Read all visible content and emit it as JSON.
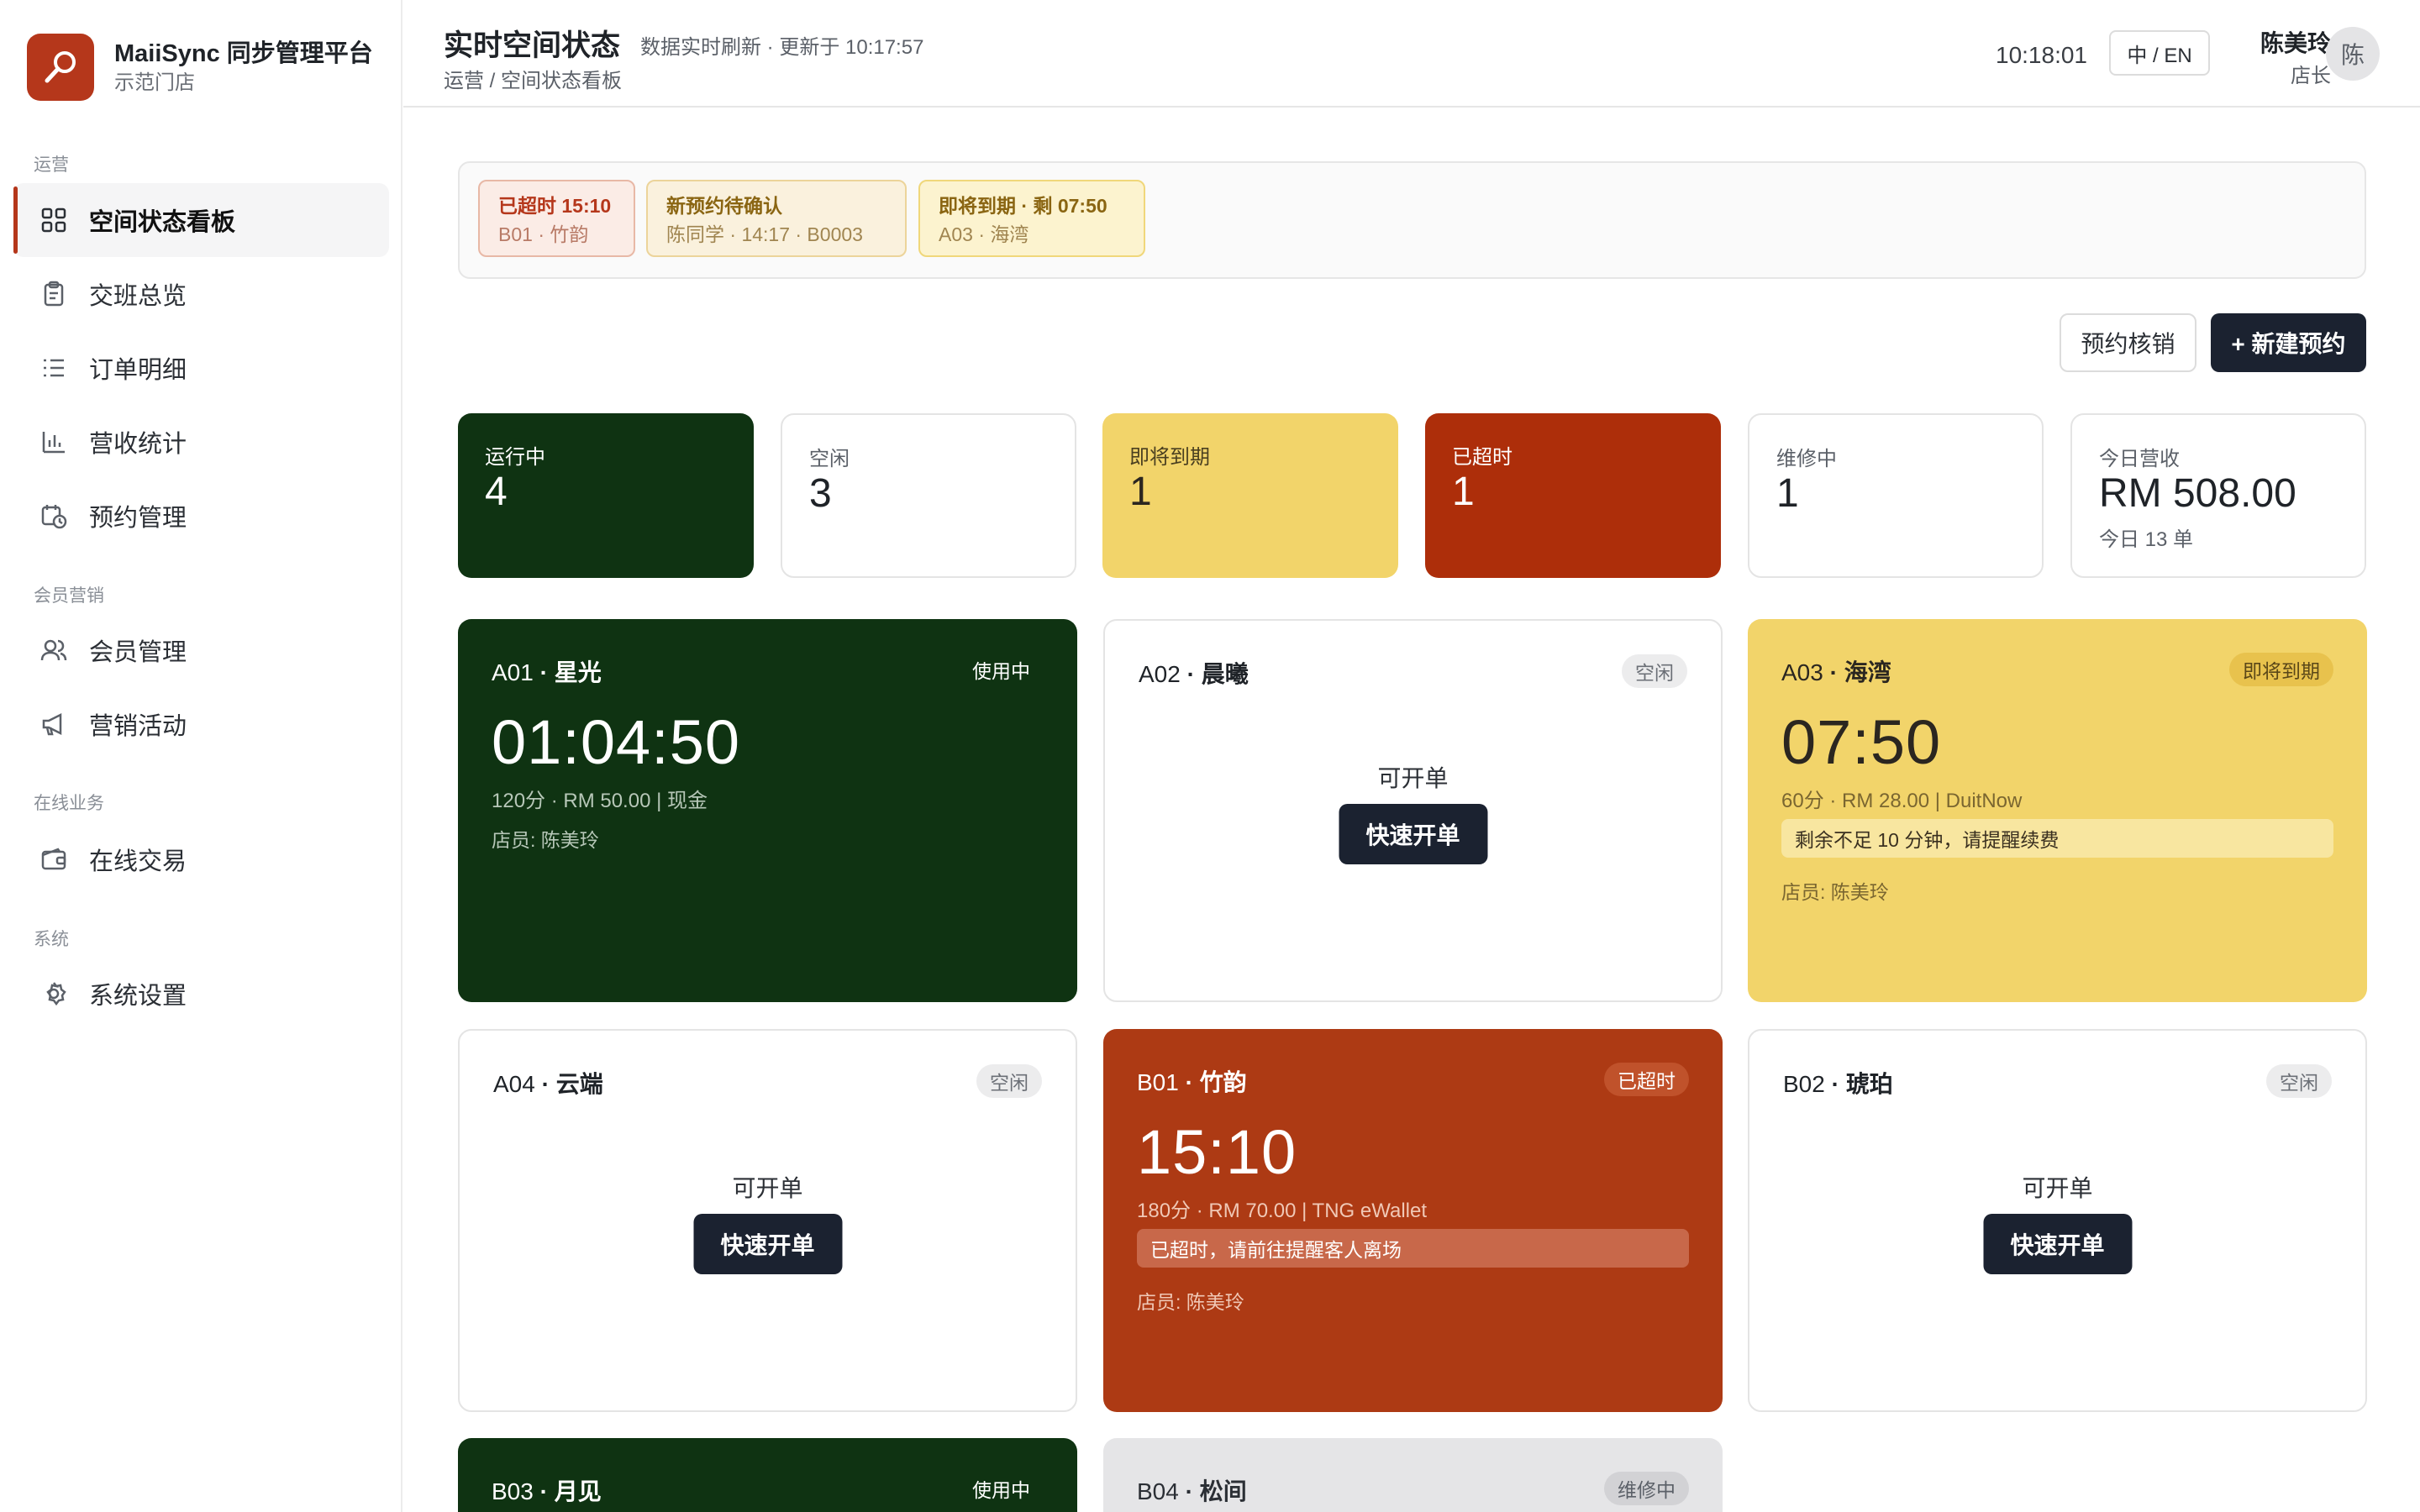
{
  "brand": {
    "name": "MaiiSync 同步管理平台",
    "store": "示范门店"
  },
  "sidebar": {
    "groups": [
      {
        "label": "运营"
      },
      {
        "label": "会员营销"
      },
      {
        "label": "在线业务"
      },
      {
        "label": "系统"
      }
    ],
    "items": [
      {
        "label": "空间状态看板",
        "icon": "grid-icon",
        "active": true
      },
      {
        "label": "交班总览",
        "icon": "clipboard-icon"
      },
      {
        "label": "订单明细",
        "icon": "list-icon"
      },
      {
        "label": "营收统计",
        "icon": "bar-chart-icon"
      },
      {
        "label": "预约管理",
        "icon": "calendar-clock-icon"
      },
      {
        "label": "会员管理",
        "icon": "users-icon"
      },
      {
        "label": "营销活动",
        "icon": "megaphone-icon"
      },
      {
        "label": "在线交易",
        "icon": "wallet-icon"
      },
      {
        "label": "系统设置",
        "icon": "gear-icon"
      }
    ]
  },
  "header": {
    "title": "实时空间状态",
    "refresh": "数据实时刷新 · 更新于 10:17:57",
    "breadcrumb": "运营 / 空间状态看板",
    "clock": "10:18:01",
    "lang": "中 / EN",
    "user_name": "陈美玲",
    "user_role": "店长",
    "avatar_text": "陈"
  },
  "alerts": [
    {
      "title": "已超时 15:10",
      "sub": "B01 · 竹韵",
      "tone": "red"
    },
    {
      "title": "新预约待确认",
      "sub": "陈同学 · 14:17 · B0003",
      "tone": "amber"
    },
    {
      "title": "即将到期 · 剩 07:50",
      "sub": "A03 · 海湾",
      "tone": "yellow"
    }
  ],
  "actions": {
    "verify": "预约核销",
    "new_booking": "+ 新建预约"
  },
  "stats": [
    {
      "label": "运行中",
      "value": "4",
      "tone": "green"
    },
    {
      "label": "空闲",
      "value": "3",
      "tone": "white"
    },
    {
      "label": "即将到期",
      "value": "1",
      "tone": "yellow"
    },
    {
      "label": "已超时",
      "value": "1",
      "tone": "red"
    },
    {
      "label": "维修中",
      "value": "1",
      "tone": "white"
    },
    {
      "label": "今日营收",
      "value": "RM 508.00",
      "sub": "今日 13 单",
      "tone": "white"
    }
  ],
  "rooms": [
    {
      "code": "A01",
      "name": "星光",
      "status": "使用中",
      "timer": "01:04:50",
      "meta": "120分 · RM 50.00 | 现金",
      "clerk": "店员: 陈美玲"
    },
    {
      "code": "A02",
      "name": "晨曦",
      "status": "空闲",
      "avail": "可开单",
      "button": "快速开单"
    },
    {
      "code": "A03",
      "name": "海湾",
      "status": "即将到期",
      "timer": "07:50",
      "meta": "60分 · RM 28.00 | DuitNow",
      "warning": "剩余不足 10 分钟，请提醒续费",
      "clerk": "店员: 陈美玲"
    },
    {
      "code": "A04",
      "name": "云端",
      "status": "空闲",
      "avail": "可开单",
      "button": "快速开单"
    },
    {
      "code": "B01",
      "name": "竹韵",
      "status": "已超时",
      "timer": "15:10",
      "meta": "180分 · RM 70.00 | TNG eWallet",
      "warning": "已超时，请前往提醒客人离场",
      "clerk": "店员: 陈美玲"
    },
    {
      "code": "B02",
      "name": "琥珀",
      "status": "空闲",
      "avail": "可开单",
      "button": "快速开单"
    },
    {
      "code": "B03",
      "name": "月见",
      "status": "使用中"
    },
    {
      "code": "B04",
      "name": "松间",
      "status": "维修中"
    }
  ],
  "colors": {
    "brand": "#b5371b",
    "running": "#0f3312",
    "expiring": "#f2d46a",
    "overdue": "#ad2e0a",
    "dark_button": "#1b2230"
  }
}
